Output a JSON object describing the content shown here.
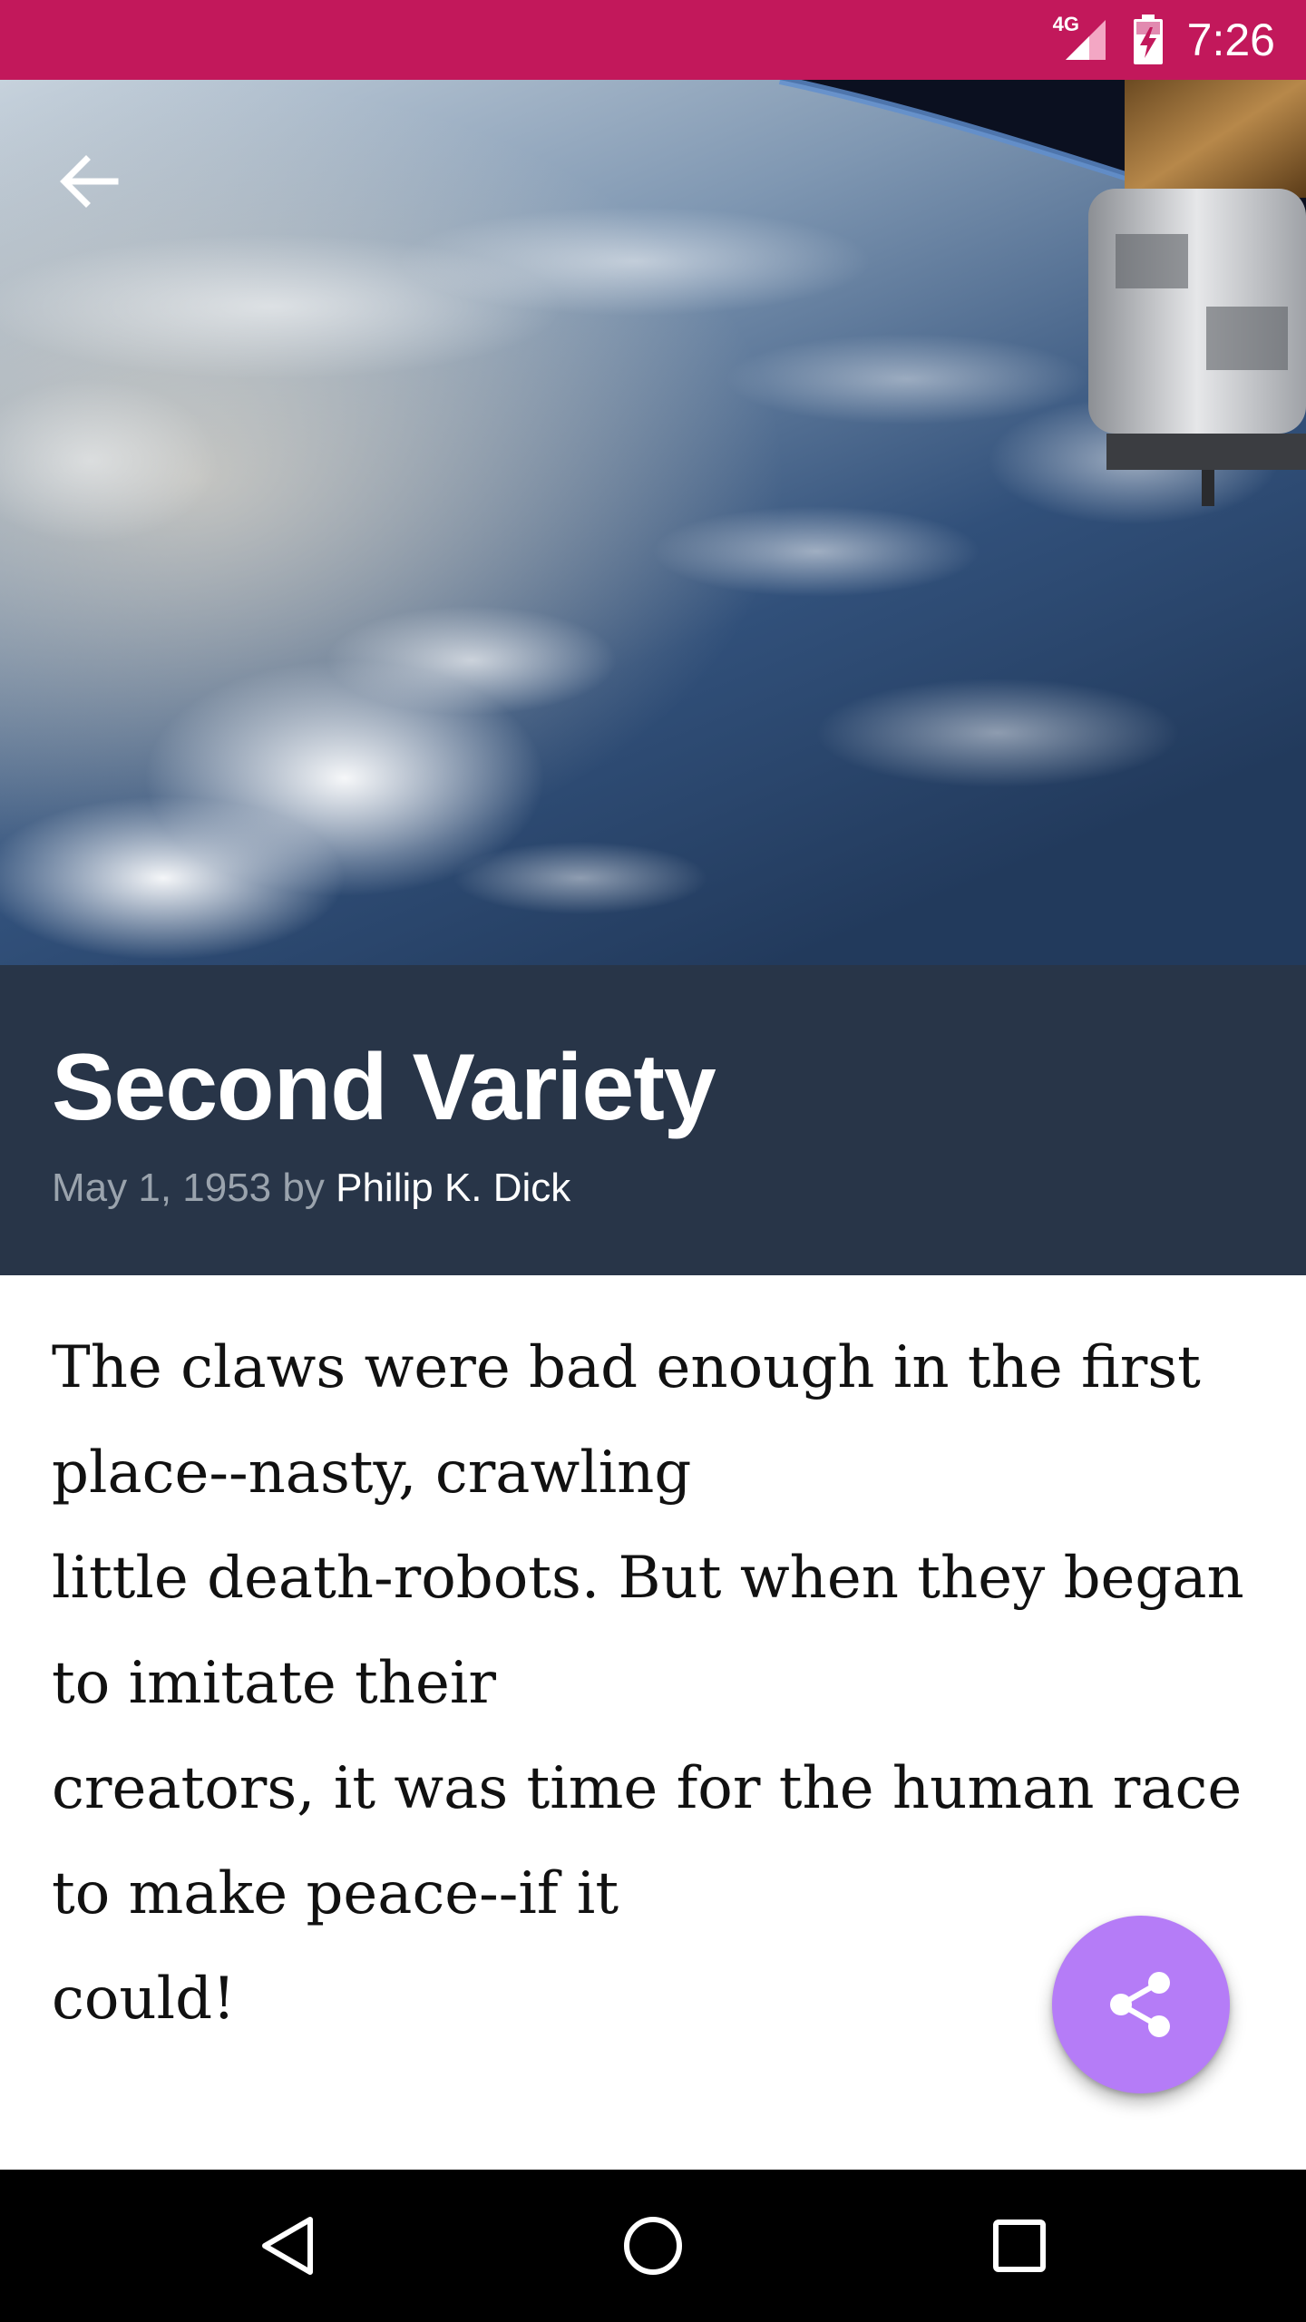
{
  "status_bar": {
    "network_label": "4G",
    "time": "7:26",
    "background": "#c2185b",
    "icons": [
      "signal-icon",
      "battery-charging-icon"
    ]
  },
  "hero": {
    "image": "earth-from-orbit-with-space-station",
    "back_icon": "arrow-back-icon"
  },
  "story": {
    "title": "Second Variety",
    "date": "May 1, 1953",
    "by": "by",
    "author": "Philip K. Dick",
    "panel_color": "#283548",
    "body_lines": [
      "The claws were bad enough in the first",
      "place--nasty, crawling",
      "little death-robots. But when they began",
      "to imitate their",
      "creators, it was time for the human race",
      "to make peace--if it",
      "could!"
    ]
  },
  "fab": {
    "icon": "share-icon",
    "color": "#b57cf7"
  },
  "nav_bar": {
    "icons": [
      "nav-back-icon",
      "nav-home-icon",
      "nav-recents-icon"
    ]
  }
}
